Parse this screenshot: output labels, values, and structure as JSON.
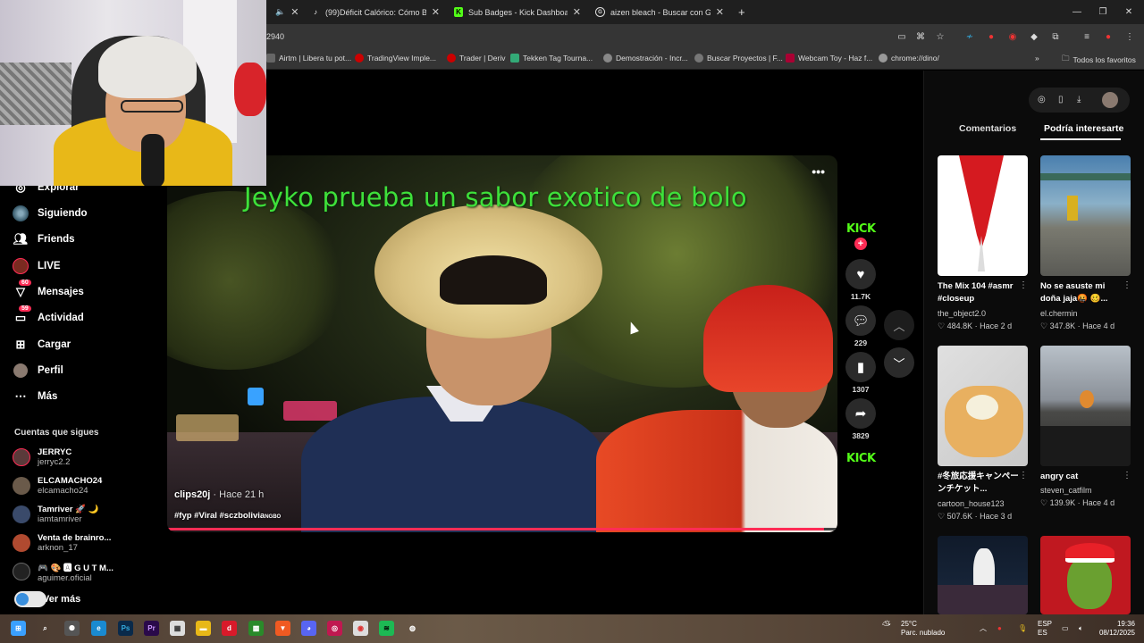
{
  "browser": {
    "tabs": [
      {
        "title": "(99)Déficit Calórico: Cómo Baja",
        "icon": "tiktok-icon"
      },
      {
        "title": "Sub Badges - Kick Dashboard",
        "icon": "kick-icon"
      },
      {
        "title": "aizen bleach - Buscar con Goog",
        "icon": "google-icon"
      }
    ],
    "url": "2940",
    "bookmarks": [
      {
        "label": "Airtm | Libera tu pot..."
      },
      {
        "label": "TradingView Imple..."
      },
      {
        "label": "Trader | Deriv"
      },
      {
        "label": "Tekken Tag Tourna..."
      },
      {
        "label": "Demostración - Incr..."
      },
      {
        "label": "Buscar Proyectos | F..."
      },
      {
        "label": "Webcam Toy - Haz f..."
      },
      {
        "label": "chrome://dino/"
      }
    ],
    "all_favorites": "Todos los favoritos",
    "new_tab": "+",
    "more_bookmarks": "»"
  },
  "sidebar": {
    "items": [
      {
        "label": "Explorar",
        "icon": "compass-icon"
      },
      {
        "label": "Siguiendo",
        "icon": "following-icon"
      },
      {
        "label": "Friends",
        "icon": "friends-icon"
      },
      {
        "label": "LIVE",
        "icon": "live-icon"
      },
      {
        "label": "Mensajes",
        "icon": "messages-icon",
        "badge": "60"
      },
      {
        "label": "Actividad",
        "icon": "activity-icon",
        "badge": "59"
      },
      {
        "label": "Cargar",
        "icon": "upload-icon"
      },
      {
        "label": "Perfil",
        "icon": "profile-icon"
      },
      {
        "label": "Más",
        "icon": "more-icon"
      }
    ],
    "follows_title": "Cuentas que sigues",
    "follows": [
      {
        "name": "JERRYC",
        "handle": "jerryc2.2"
      },
      {
        "name": "ELCAMACHO24",
        "handle": "elcamacho24"
      },
      {
        "name": "Tamriver 🚀 🌙",
        "handle": "iamtamriver"
      },
      {
        "name": "Venta de brainro...",
        "handle": "arknon_17"
      },
      {
        "name": "🎮 🎨 🅰 G U T M...",
        "handle": "aguimer.oficial"
      }
    ],
    "see_more": "Ver más"
  },
  "video": {
    "caption": "Jeyko prueba un sabor exotico de bolo",
    "author": "clips20j",
    "time": "· Hace 21 h",
    "tags": "#fyp #Viral #sczbolivia",
    "tag_suffix": "NGBO",
    "progress": 0.98,
    "more": "•••"
  },
  "actions": {
    "brand": "KICK",
    "likes": "11.7K",
    "comments": "229",
    "saves": "1307",
    "shares": "3829"
  },
  "right_panel": {
    "tabs": [
      "Comentarios",
      "Podría interesarte"
    ],
    "active_tab": 1,
    "cards": [
      {
        "title": "The Mix 104 #asmr #closeup",
        "author": "the_object2.0",
        "likes": "484.8K",
        "time": "Hace 2 d"
      },
      {
        "title": "No se asuste mi doña jaja🤬 🥴...",
        "author": "el.chermin",
        "likes": "347.8K",
        "time": "Hace 4 d"
      },
      {
        "title": "#冬旅応援キャンペーンチケット...",
        "author": "cartoon_house123",
        "likes": "507.6K",
        "time": "Hace 3 d"
      },
      {
        "title": "angry cat",
        "author": "steven_catfilm",
        "likes": "139.9K",
        "time": "Hace 4 d"
      }
    ]
  },
  "taskbar": {
    "weather_temp": "25°C",
    "weather_desc": "Parc. nublado",
    "lang1": "ESP",
    "lang2": "ES",
    "time": "19:36",
    "date": "08/12/2025"
  },
  "colors": {
    "accent": "#fe2c55",
    "kick": "#53fc18",
    "caption": "#3ee03a"
  }
}
